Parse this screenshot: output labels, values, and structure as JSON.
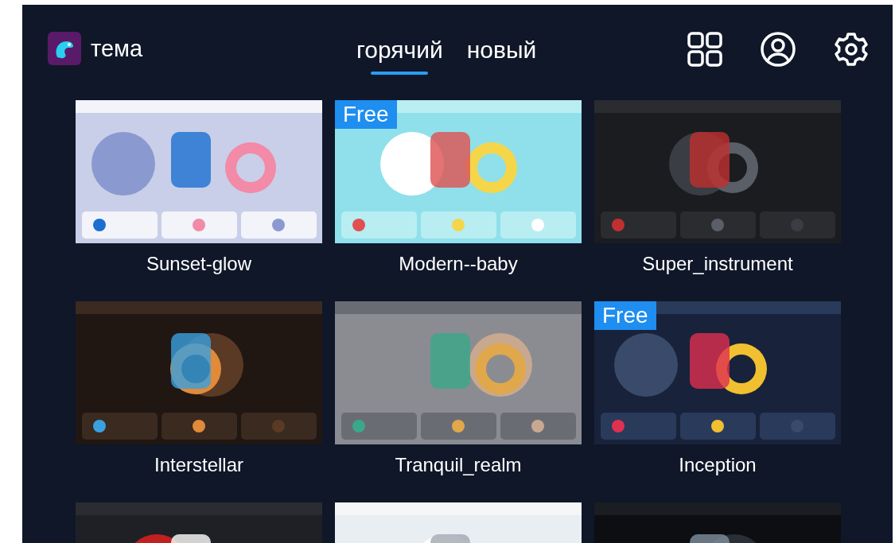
{
  "header": {
    "title": "тема"
  },
  "tabs": [
    {
      "label": "горячий",
      "selected": true
    },
    {
      "label": "новый",
      "selected": false
    }
  ],
  "themes": [
    {
      "name": "Sunset-glow",
      "kind": "picture"
    },
    {
      "name": "Modern--baby",
      "badge": "Free",
      "kind": "picture"
    },
    {
      "name": "Super_instrument",
      "kind": "picture"
    },
    {
      "name": "Interstellar",
      "kind": "picture"
    },
    {
      "name": "Tranquil_realm",
      "kind": "picture"
    },
    {
      "name": "Inception",
      "badge": "Free",
      "kind": "picture"
    },
    {
      "kind": "picture"
    },
    {
      "kind": "picture"
    },
    {
      "kind": "picture"
    }
  ]
}
